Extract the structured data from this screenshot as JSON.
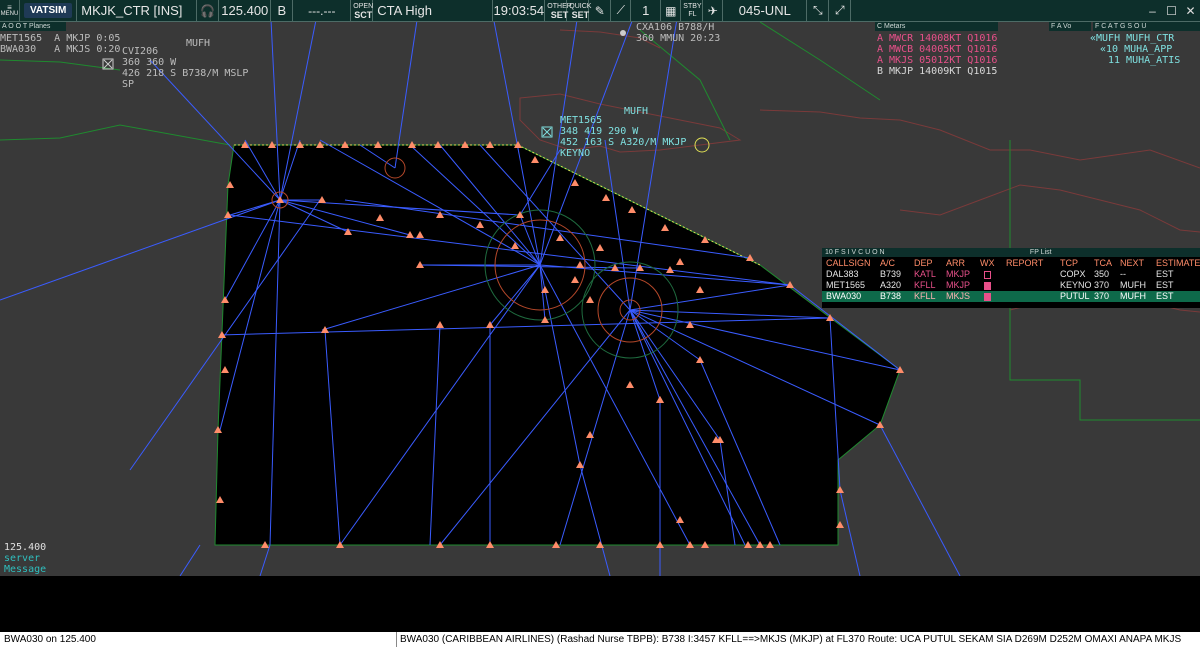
{
  "topbar": {
    "menu_label": "MENU",
    "logo_text": "VATSIM",
    "callsign": "MKJK_CTR [INS]",
    "frequency": "125.400",
    "atis_letter": "B",
    "freq_placeholder": "---.---",
    "open_sct_label_top": "OPEN",
    "open_sct_label_bottom": "SCT",
    "sector_name": "CTA High",
    "clock": "19:03:54",
    "other_set_top": "OTHER",
    "other_set_bottom": "SET",
    "quick_set_top": "QUICK",
    "quick_set_bottom": "SET",
    "counter": "1",
    "stby_top": "STBY",
    "stby_bottom": "FL",
    "altitude_filter": "045-UNL"
  },
  "panels": {
    "planes_header": "A O O T  Planes",
    "planes_rows": [
      "MET1565  A MKJP 0:05",
      "BWA030   A MKJS 0:20"
    ],
    "metars_header": "C                      Metars",
    "metars_rows": [
      {
        "text": "A MWCR 14008KT Q1016",
        "color": "#e8508a"
      },
      {
        "text": "A MWCB 04005KT Q1016",
        "color": "#e8508a"
      },
      {
        "text": "A MKJS 05012KT Q1016",
        "color": "#e8508a"
      },
      {
        "text": "B MKJP 14009KT Q1015",
        "color": "#d8d8d8"
      }
    ],
    "fav_header": "F A Vo",
    "atc_header": "F C A T G S O U",
    "atc_rows": [
      "«MUFH MUFH_CTR",
      "«10 MUHA_APP",
      "11 MUHA_ATIS"
    ]
  },
  "map_labels": {
    "mufh_1": "MUFH",
    "mufh_2": "MUFH",
    "cvi_tag": [
      "CVI206",
      "360 360 W",
      "426 218 S B738/M MSLP",
      "SP"
    ],
    "met_tag": [
      "MET1565",
      "348 419 290 W",
      "452 163 S A320/M MKJP",
      "KEYNO"
    ],
    "cxa_tag": [
      "CXA106 B788/H",
      "360 MMUN 20:23"
    ]
  },
  "fp_list": {
    "title": "FP List",
    "header_left": "10 F S I V C U O N",
    "columns": [
      "CALLSIGN",
      "A/C",
      "DEP",
      "ARR",
      "WX",
      "REPORT",
      "TCP",
      "TCA",
      "NEXT",
      "ESTIMATE"
    ],
    "rows": [
      {
        "callsign": "DAL383",
        "ac": "B739",
        "dep": "KATL",
        "arr": "MKJP",
        "tcp": "COPX",
        "tca": "350",
        "next": "--",
        "est": "EST"
      },
      {
        "callsign": "MET1565",
        "ac": "A320",
        "dep": "KFLL",
        "arr": "MKJP",
        "tcp": "KEYNO",
        "tca": "370",
        "next": "MUFH",
        "est": "EST"
      },
      {
        "callsign": "BWA030",
        "ac": "B738",
        "dep": "KFLL",
        "arr": "MKJS",
        "tcp": "PUTUL",
        "tca": "370",
        "next": "MUFH",
        "est": "EST"
      }
    ]
  },
  "messages": {
    "freq": "125.400",
    "line2": "server",
    "line3": "Message"
  },
  "cmdline": {
    "left": "BWA030 on 125.400",
    "right": "BWA030 (CARIBBEAN AIRLINES) (Rashad Nurse TBPB): B738 I:3457 KFLL==>MKJS (MKJP) at FL370 Route: UCA PUTUL SEKAM SIA D269M D252M OMAXI ANAPA MKJS"
  },
  "colors": {
    "bg": "#393939",
    "sector_fill": "#000000",
    "route": "#3a5cff",
    "fix": "#ff8c69",
    "coast": "#7a3a3a",
    "boundary": "#1f8a2f"
  }
}
